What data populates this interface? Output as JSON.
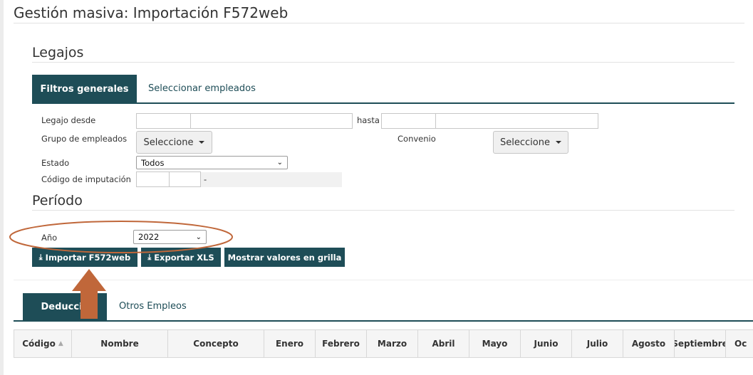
{
  "page": {
    "title": "Gestión masiva: Importación F572web"
  },
  "legajos": {
    "title": "Legajos",
    "tabs": {
      "active": "Filtros generales",
      "other": "Seleccionar empleados"
    },
    "filters": {
      "legajo_desde_label": "Legajo desde",
      "hasta_label": "hasta",
      "grupo_label": "Grupo de empleados",
      "grupo_value": "Seleccione",
      "convenio_label": "Convenio",
      "convenio_value": "Seleccione",
      "estado_label": "Estado",
      "estado_value": "Todos",
      "codigo_label": "Código de imputación",
      "codigo_separator": "-"
    }
  },
  "periodo": {
    "title": "Período",
    "anio_label": "Año",
    "anio_value": "2022"
  },
  "actions": {
    "importar": "Importar F572web",
    "exportar": "Exportar XLS",
    "mostrar": "Mostrar valores en grilla"
  },
  "bottom_tabs": {
    "active": "Deduccio",
    "other": "Otros Empleos"
  },
  "grid": {
    "columns": [
      "Código",
      "Nombre",
      "Concepto",
      "Enero",
      "Febrero",
      "Marzo",
      "Abril",
      "Mayo",
      "Junio",
      "Julio",
      "Agosto",
      "Septiembre",
      "Oc"
    ]
  },
  "colors": {
    "accent": "#1e4d57",
    "annotation": "#c0673a"
  }
}
